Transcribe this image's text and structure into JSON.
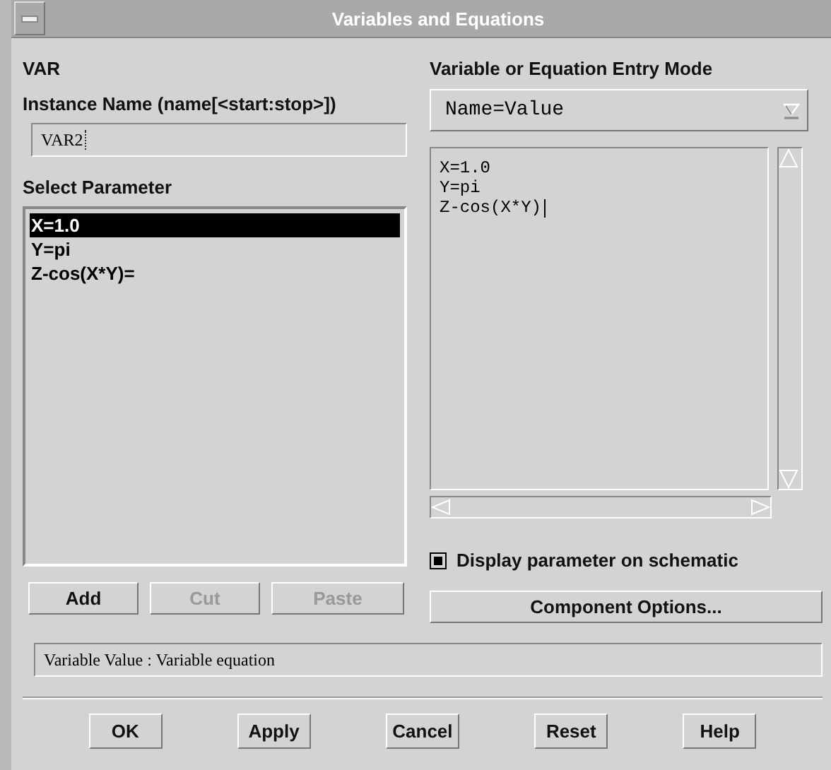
{
  "window": {
    "title": "Variables and Equations"
  },
  "component": "VAR",
  "instance_name": {
    "label": "Instance Name  (name[<start:stop>])",
    "value": "VAR2"
  },
  "select_parameter": {
    "label": "Select Parameter",
    "items": [
      {
        "text": "X=1.0",
        "selected": true
      },
      {
        "text": "Y=pi",
        "selected": false
      },
      {
        "text": "Z-cos(X*Y)=",
        "selected": false
      }
    ]
  },
  "list_buttons": [
    {
      "label": "Add",
      "disabled": false
    },
    {
      "label": "Cut",
      "disabled": true
    },
    {
      "label": "Paste",
      "disabled": true
    }
  ],
  "entry_mode": {
    "label": "Variable or Equation Entry Mode",
    "value": "Name=Value"
  },
  "editor_lines": [
    "X=1.0",
    "Y=pi",
    "Z-cos(X*Y)"
  ],
  "display_on_schematic": {
    "label": "Display parameter on schematic",
    "checked": true
  },
  "component_options": {
    "label": "Component Options..."
  },
  "status": "Variable Value : Variable equation",
  "buttons": [
    "OK",
    "Apply",
    "Cancel",
    "Reset",
    "Help"
  ]
}
